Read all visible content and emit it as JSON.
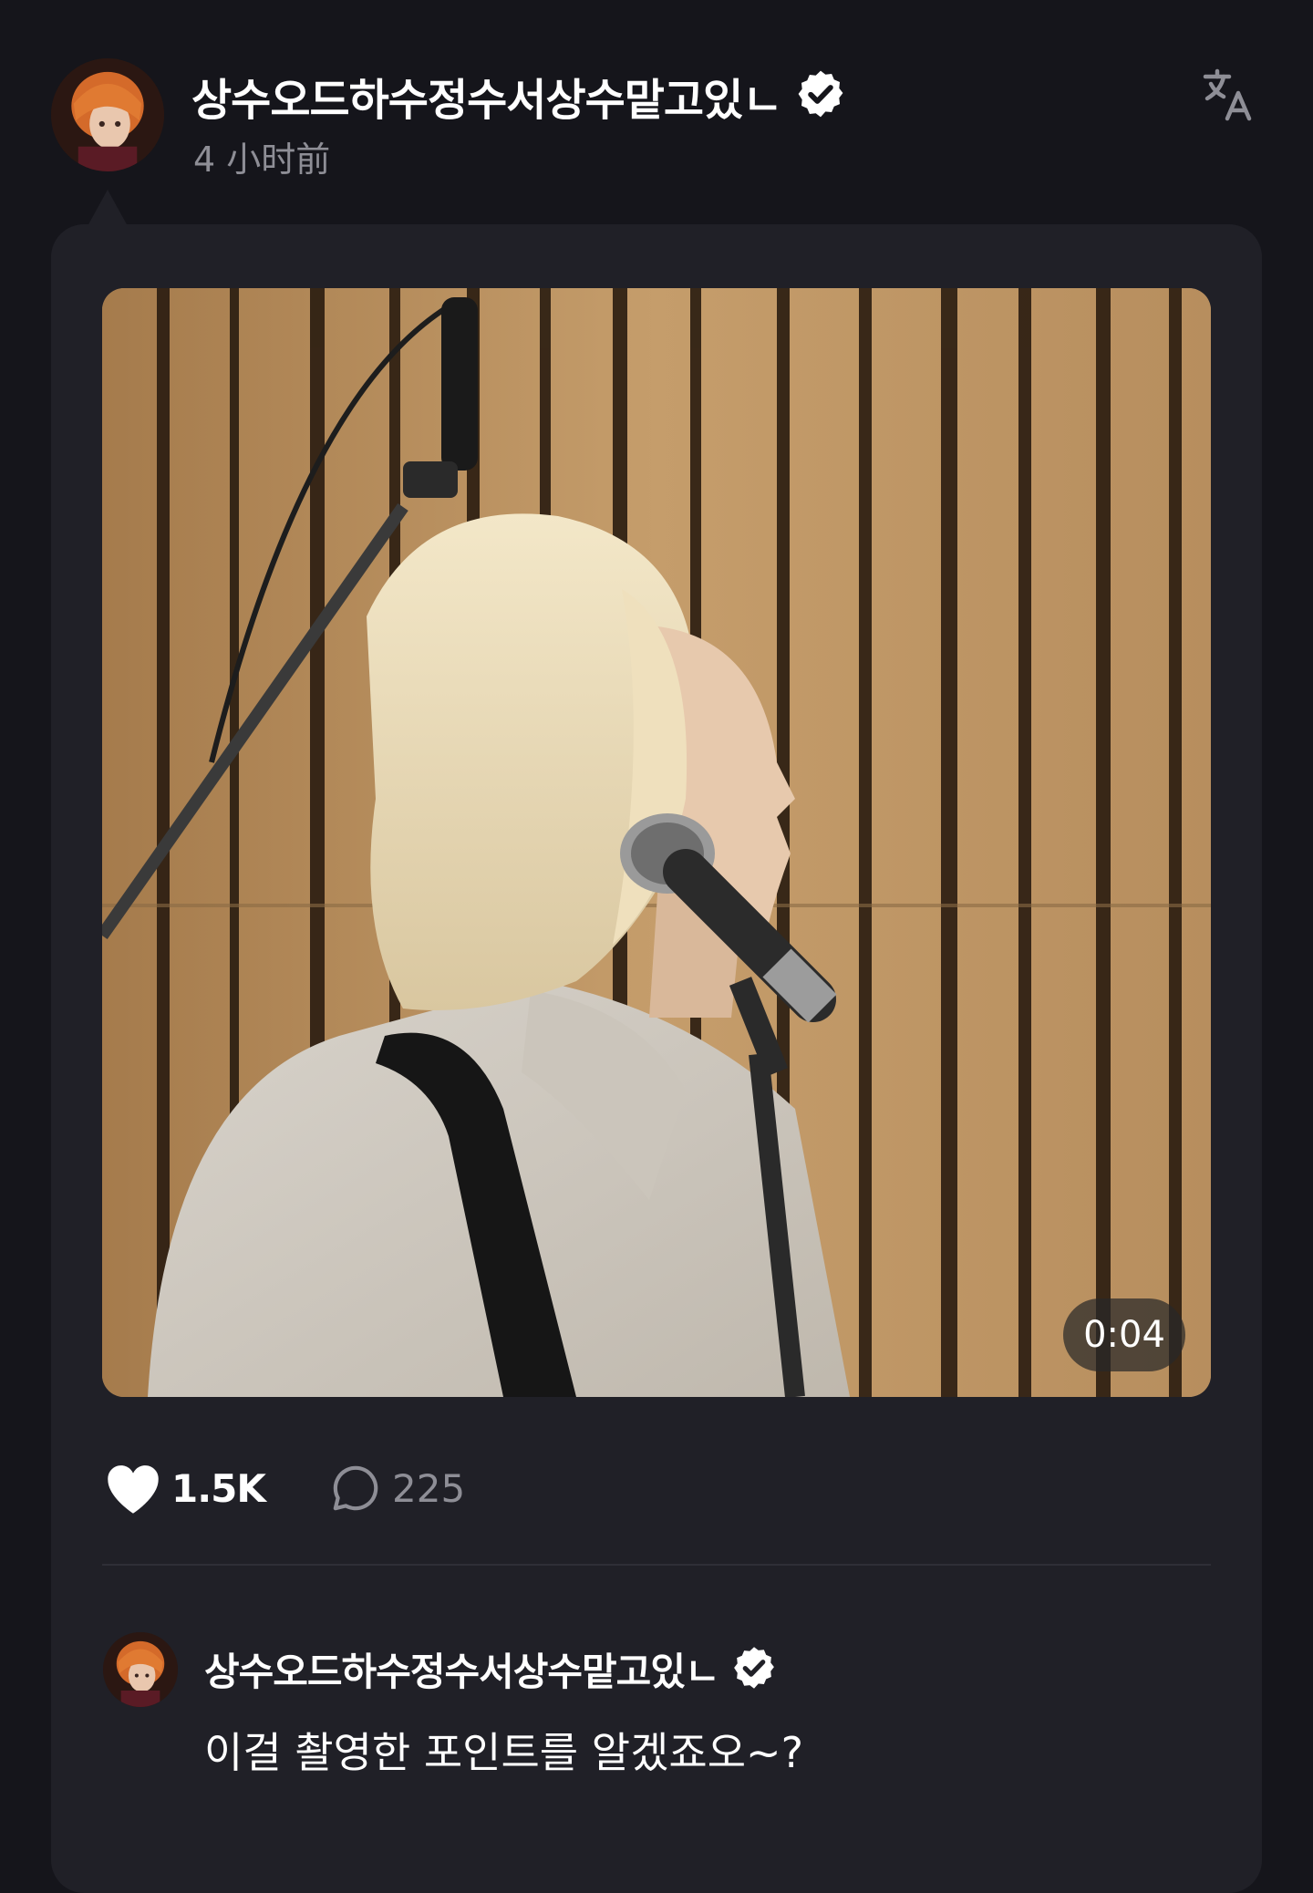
{
  "post": {
    "author": {
      "name": "상수오드하수정수서상수맡고있ㄴ",
      "verified": true
    },
    "timestamp": "4 小时前",
    "translate_icon": "translate-icon",
    "media": {
      "type": "video",
      "duration": "0:04"
    },
    "stats": {
      "likes": "1.5K",
      "comments": "225"
    }
  },
  "comment": {
    "author": {
      "name": "상수오드하수정수서상수맡고있ㄴ",
      "verified": true
    },
    "text": "이걸 촬영한 포인트를 알겠죠오~?"
  },
  "colors": {
    "background": "#15151b",
    "card": "#202027",
    "text_primary": "#ffffff",
    "text_secondary": "#8e8e96",
    "verified_badge": "#ffffff"
  }
}
